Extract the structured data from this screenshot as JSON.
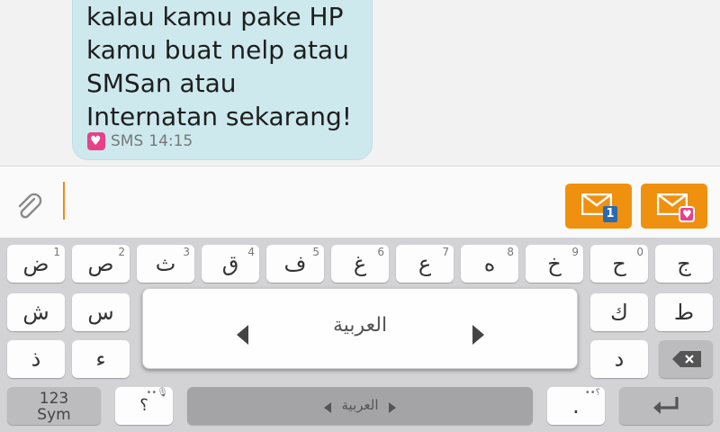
{
  "message": {
    "text": "kalau kamu pake HP\nkamu buat nelp atau\nSMSan atau\nInternatan sekarang!",
    "type": "SMS",
    "time": "14:15"
  },
  "compose": {
    "attach_icon": "paperclip-icon",
    "send_sim1_badge": "1",
    "accent": "#f0900f"
  },
  "keyboard": {
    "row1": [
      {
        "char": "ض",
        "hint": "1"
      },
      {
        "char": "ص",
        "hint": "2"
      },
      {
        "char": "ث",
        "hint": "3"
      },
      {
        "char": "ق",
        "hint": "4"
      },
      {
        "char": "ف",
        "hint": "5"
      },
      {
        "char": "غ",
        "hint": "6"
      },
      {
        "char": "ع",
        "hint": "7"
      },
      {
        "char": "ه",
        "hint": "8"
      },
      {
        "char": "خ",
        "hint": "9"
      },
      {
        "char": "ح",
        "hint": "0"
      },
      {
        "char": "ج",
        "hint": ""
      }
    ],
    "row2_visible": [
      "ش",
      "س",
      "ك",
      "ط"
    ],
    "row3_visible": [
      "ذ",
      "ء",
      "د"
    ],
    "sym_label_top": "123",
    "sym_label_bottom": "Sym",
    "question_key": "؟",
    "period_key": ".",
    "space_label": "العربية",
    "language_popup_label": "العربية"
  }
}
